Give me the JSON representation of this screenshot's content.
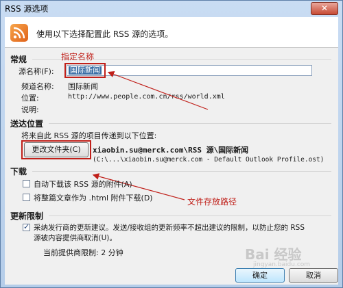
{
  "window": {
    "title": "RSS 源选项",
    "close_glyph": "✕"
  },
  "header": {
    "text": "使用以下选择配置此 RSS 源的选项。",
    "icon": "rss-icon"
  },
  "general": {
    "heading": "常规",
    "name_label": "源名称(F):",
    "name_value": "国际新闻",
    "channel_label": "频道名称:",
    "channel_value": "国际新闻",
    "location_label": "位置:",
    "location_value": "http://www.people.com.cn/rss/world.xml",
    "description_label": "说明:"
  },
  "delivery": {
    "heading": "送达位置",
    "intro": "将来自此 RSS 源的项目传递到以下位置:",
    "change_folder_button": "更改文件夹(C)",
    "folder_path": "xiaobin.su@merck.com\\RSS 源\\国际新闻",
    "folder_detail": "(C:\\...\\xiaobin.su@merck.com - Default Outlook Profile.ost)"
  },
  "download": {
    "heading": "下载",
    "auto_download_label": "自动下载该 RSS 源的附件(A)",
    "auto_download_checked": false,
    "full_article_label": "将整篇文章作为 .html 附件下载(D)",
    "full_article_checked": false
  },
  "update_limit": {
    "heading": "更新限制",
    "checkbox_label_line1": "采纳发行商的更新建议。发送/接收组的更新频率不超出建议的限制，以防止您的 RSS",
    "checkbox_label_line2": "源被内容提供商取消(U)。",
    "checked": true,
    "current_limit": "当前提供商限制:  2 分钟"
  },
  "buttons": {
    "ok": "确定",
    "cancel": "取消"
  },
  "annotations": {
    "name_note": "指定名称",
    "path_note": "文件存放路径",
    "color": "#c0201a"
  },
  "watermark": {
    "text": "Bai 经验",
    "url": "jingyan.baidu.com"
  }
}
